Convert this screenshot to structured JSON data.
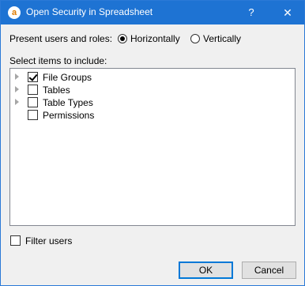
{
  "window": {
    "title": "Open Security in Spreadsheet",
    "help": "?",
    "close": "✕",
    "app_icon_letter": "a"
  },
  "present": {
    "label": "Present users and roles:",
    "options": [
      {
        "label": "Horizontally",
        "selected": true
      },
      {
        "label": "Vertically",
        "selected": false
      }
    ]
  },
  "select": {
    "label": "Select items to include:",
    "items": [
      {
        "label": "File Groups",
        "checked": true,
        "expandable": true
      },
      {
        "label": "Tables",
        "checked": false,
        "expandable": true
      },
      {
        "label": "Table Types",
        "checked": false,
        "expandable": true
      },
      {
        "label": "Permissions",
        "checked": false,
        "expandable": false
      }
    ]
  },
  "filter": {
    "label": "Filter users",
    "checked": false
  },
  "buttons": {
    "ok": "OK",
    "cancel": "Cancel"
  },
  "colors": {
    "titlebar": "#1e73d3",
    "dialog_bg": "#f0f0f0",
    "accent": "#0078d7"
  }
}
